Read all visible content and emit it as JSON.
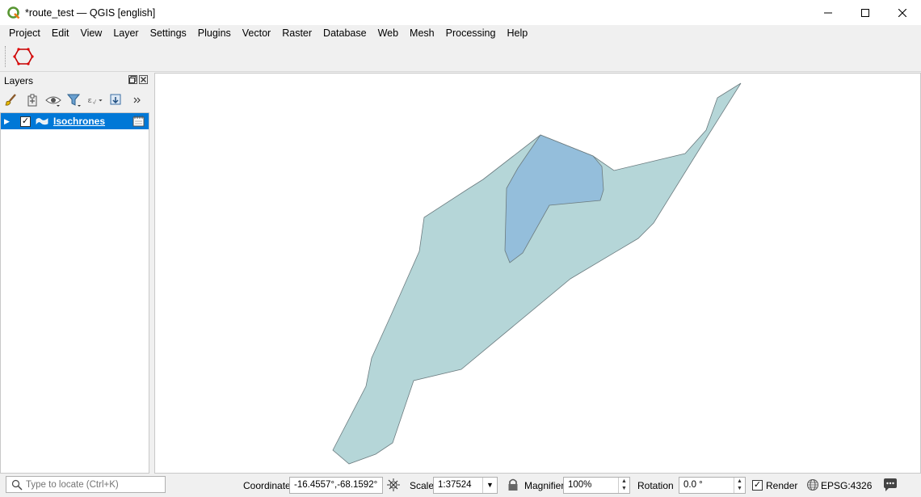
{
  "window": {
    "title": "*route_test — QGIS [english]"
  },
  "menubar": {
    "items": [
      "Project",
      "Edit",
      "View",
      "Layer",
      "Settings",
      "Plugins",
      "Vector",
      "Raster",
      "Database",
      "Web",
      "Mesh",
      "Processing",
      "Help"
    ]
  },
  "layers_panel": {
    "title": "Layers",
    "layers": [
      {
        "name": "Isochrones",
        "checked": "✓"
      }
    ]
  },
  "map": {
    "polygon_fill_outer": "#b5d6d8",
    "polygon_fill_inner": "#94bedb",
    "polygon_stroke": "#6b7b7f"
  },
  "statusbar": {
    "locate_placeholder": "Type to locate (Ctrl+K)",
    "coordinate_label": "Coordinate",
    "coordinate_value": "-16.4557°,-68.1592°",
    "scale_label": "Scale",
    "scale_value": "1:37524",
    "magnifier_label": "Magnifier",
    "magnifier_value": "100%",
    "rotation_label": "Rotation",
    "rotation_value": "0.0 °",
    "render_label": "Render",
    "render_checked": "✓",
    "crs_value": "EPSG:4326"
  },
  "colors": {
    "selection": "#0078d7",
    "qgis_green": "#589632"
  }
}
